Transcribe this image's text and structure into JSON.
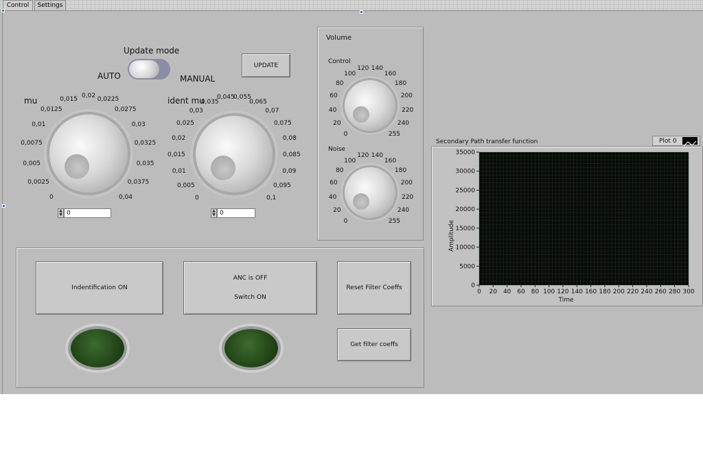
{
  "tabs": {
    "control": "Control",
    "settings": "Settings"
  },
  "update_mode": {
    "title": "Update mode",
    "auto": "AUTO",
    "manual": "MANUAL",
    "update_button": "UPDATE"
  },
  "mu_knob": {
    "label": "mu",
    "ticks": [
      "0",
      "0,0025",
      "0,005",
      "0,0075",
      "0,01",
      "0,0125",
      "0,015",
      "0,02",
      "0,0225",
      "0,0275",
      "0,03",
      "0,0325",
      "0,035",
      "0,0375",
      "0,04"
    ],
    "value": "0"
  },
  "ident_mu_knob": {
    "label": "ident mu",
    "ticks": [
      "0",
      "0,005",
      "0,01",
      "0,015",
      "0,02",
      "0,025",
      "0,03",
      "0,035",
      "0,045",
      "0,055",
      "0,065",
      "0,07",
      "0,075",
      "0,08",
      "0,085",
      "0,09",
      "0,095",
      "0,1"
    ],
    "value": "0"
  },
  "volume": {
    "title": "Volume",
    "control": {
      "label": "Control",
      "ticks": [
        "0",
        "20",
        "40",
        "60",
        "80",
        "100",
        "120",
        "140",
        "160",
        "180",
        "200",
        "220",
        "240",
        "255"
      ]
    },
    "noise": {
      "label": "Noise",
      "ticks": [
        "0",
        "20",
        "40",
        "60",
        "80",
        "100",
        "120",
        "140",
        "160",
        "180",
        "200",
        "220",
        "240",
        "255"
      ]
    }
  },
  "buttons": {
    "identification": "Indentification ON",
    "anc_status": "ANC is OFF",
    "anc_switch": "Switch ON",
    "reset_filter": "Reset Filter Coeffs",
    "get_filter": "Get filter coeffs"
  },
  "graph": {
    "title": "Secondary Path transfer function",
    "legend": "Plot 0",
    "ylabel": "Amplitude",
    "xlabel": "Time",
    "yticks": [
      "35000",
      "30000",
      "25000",
      "20000",
      "15000",
      "10000",
      "5000",
      "0"
    ],
    "xticks": [
      "0",
      "20",
      "40",
      "60",
      "80",
      "100",
      "120",
      "140",
      "160",
      "180",
      "200",
      "220",
      "240",
      "260",
      "280",
      "300"
    ]
  },
  "colors": {
    "led_off": "#1f4014",
    "plot_bg": "#0a0a0a",
    "grid": "#1e5a1e"
  },
  "chart_data": {
    "type": "line",
    "title": "Secondary Path transfer function",
    "xlabel": "Time",
    "ylabel": "Amplitude",
    "xlim": [
      0,
      300
    ],
    "ylim": [
      0,
      35000
    ],
    "grid": true,
    "legend_placement": "top-right",
    "series": [
      {
        "name": "Plot 0",
        "values": []
      }
    ]
  }
}
